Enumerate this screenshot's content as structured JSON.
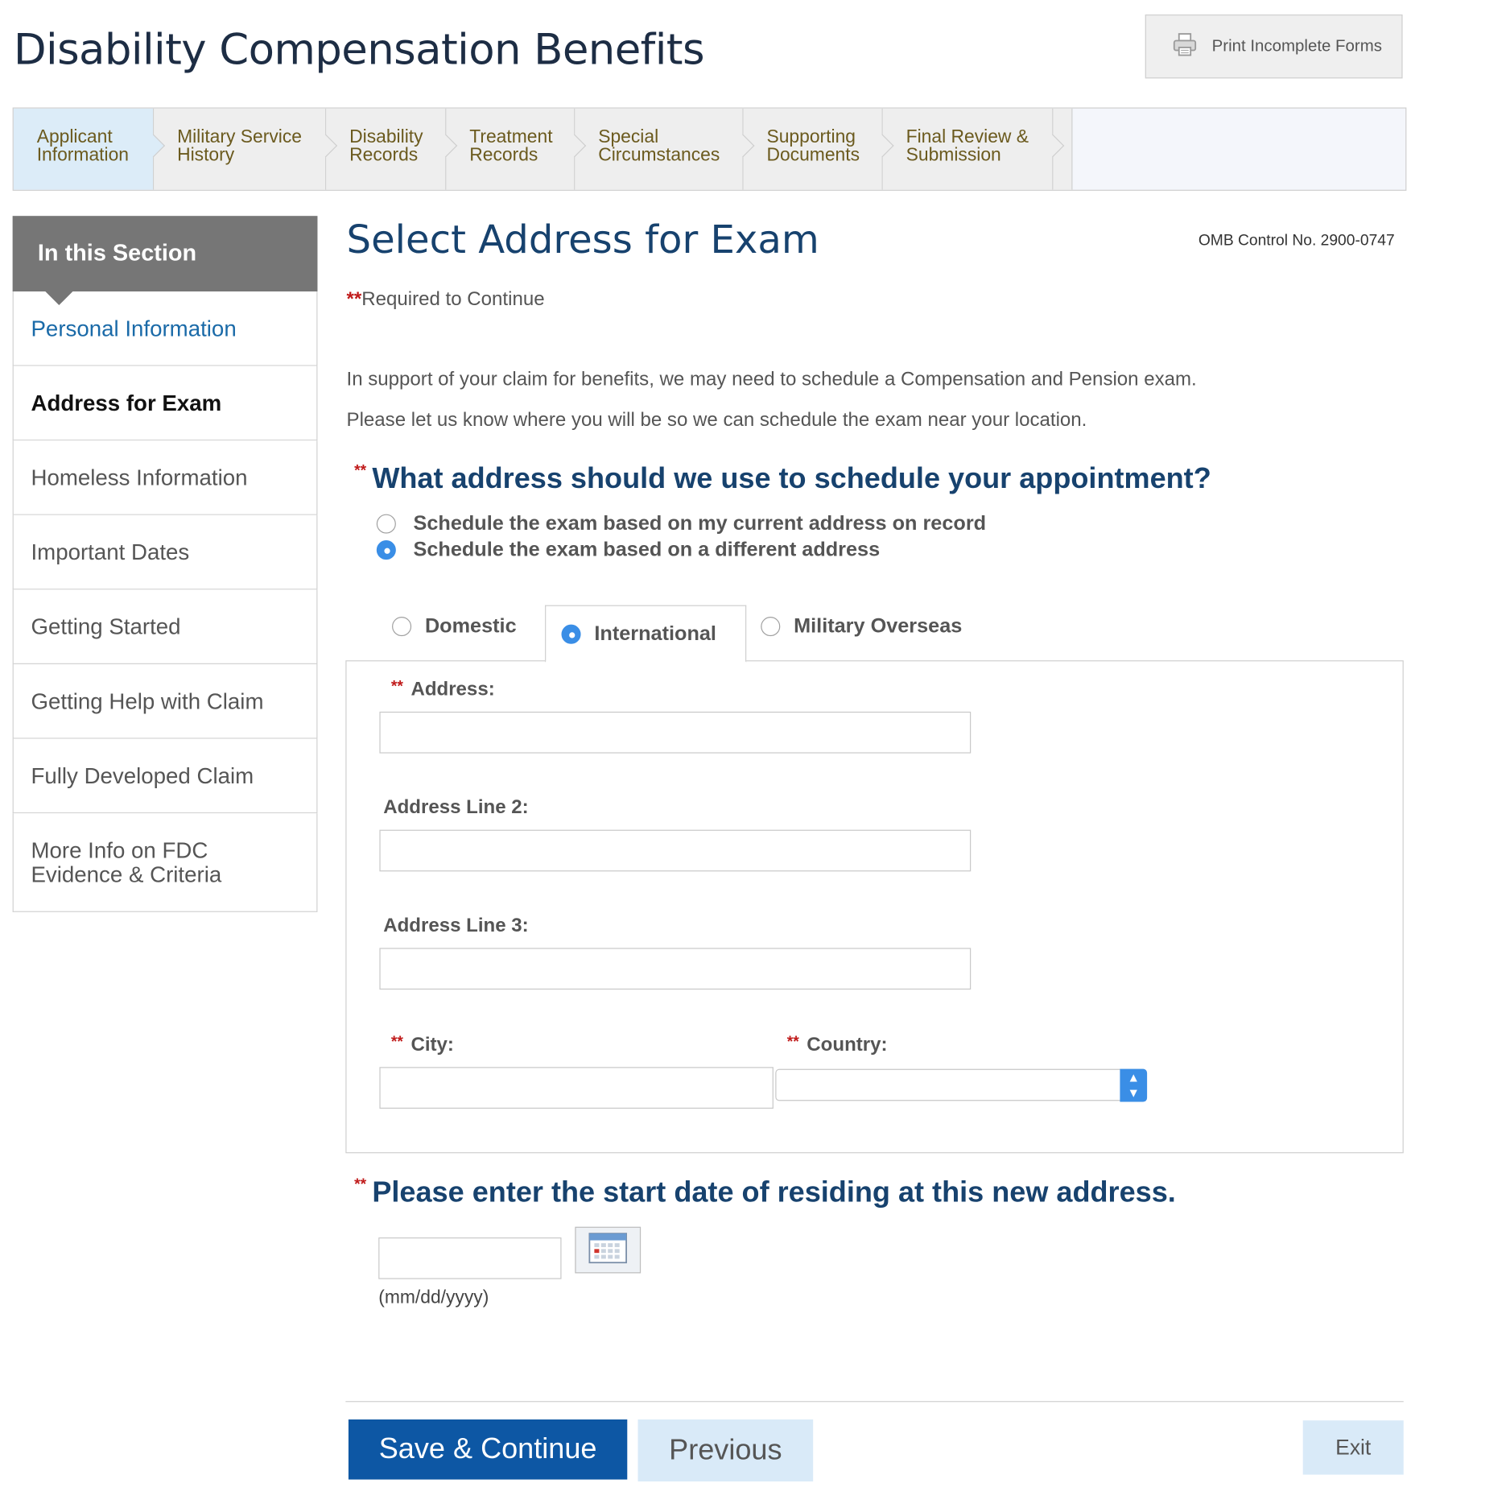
{
  "app": {
    "title": "Disability Compensation Benefits"
  },
  "header": {
    "print_label": "Print Incomplete Forms"
  },
  "steps": [
    {
      "label": "Applicant\nInformation",
      "active": true
    },
    {
      "label": "Military Service\nHistory"
    },
    {
      "label": "Disability\nRecords"
    },
    {
      "label": "Treatment\nRecords"
    },
    {
      "label": "Special\nCircumstances"
    },
    {
      "label": "Supporting\nDocuments"
    },
    {
      "label": "Final Review &\nSubmission"
    }
  ],
  "sidebar": {
    "heading": "In this Section",
    "items": [
      {
        "label": "Personal Information"
      },
      {
        "label": "Address for Exam"
      },
      {
        "label": "Homeless Information"
      },
      {
        "label": "Important Dates"
      },
      {
        "label": "Getting Started"
      },
      {
        "label": "Getting Help with Claim"
      },
      {
        "label": "Fully Developed Claim"
      },
      {
        "label": "More Info on FDC\nEvidence & Criteria"
      }
    ]
  },
  "main": {
    "heading": "Select Address for Exam",
    "omb": "OMB Control No. 2900-0747",
    "required_marker": "**",
    "required_text": "Required to Continue",
    "intro_1": "In support of your claim for benefits, we may need to schedule a Compensation and Pension exam.",
    "intro_2": "Please let us know where you will be so we can schedule the exam near your location.",
    "question_1": "What address should we use to schedule your appointment?",
    "options": [
      {
        "label": "Schedule the exam based on my current address on record",
        "selected": false
      },
      {
        "label": "Schedule the exam based on a different address",
        "selected": true
      }
    ],
    "address_tabs": [
      {
        "label": "Domestic",
        "selected": false
      },
      {
        "label": "International",
        "selected": true
      },
      {
        "label": "Military Overseas",
        "selected": false
      }
    ],
    "form": {
      "address_label": "Address:",
      "address_value": "",
      "address2_label": "Address Line 2:",
      "address2_value": "",
      "address3_label": "Address Line 3:",
      "address3_value": "",
      "city_label": "City:",
      "city_value": "",
      "country_label": "Country:",
      "country_value": ""
    },
    "question_2": "Please enter the start date of residing at this new address.",
    "date_value": "",
    "date_hint": "(mm/dd/yyyy)"
  },
  "footer": {
    "save_label": "Save & Continue",
    "previous_label": "Previous",
    "exit_label": "Exit"
  },
  "colors": {
    "heading": "#17426e",
    "link": "#1a6aa8",
    "required": "#c01a1a",
    "primary_button": "#0d57a4",
    "secondary_button": "#d9eaf8",
    "radio_selected": "#3a8ee6"
  },
  "icons": {
    "print": "printer-icon",
    "calendar": "calendar-icon",
    "select": "select-arrows-icon"
  }
}
